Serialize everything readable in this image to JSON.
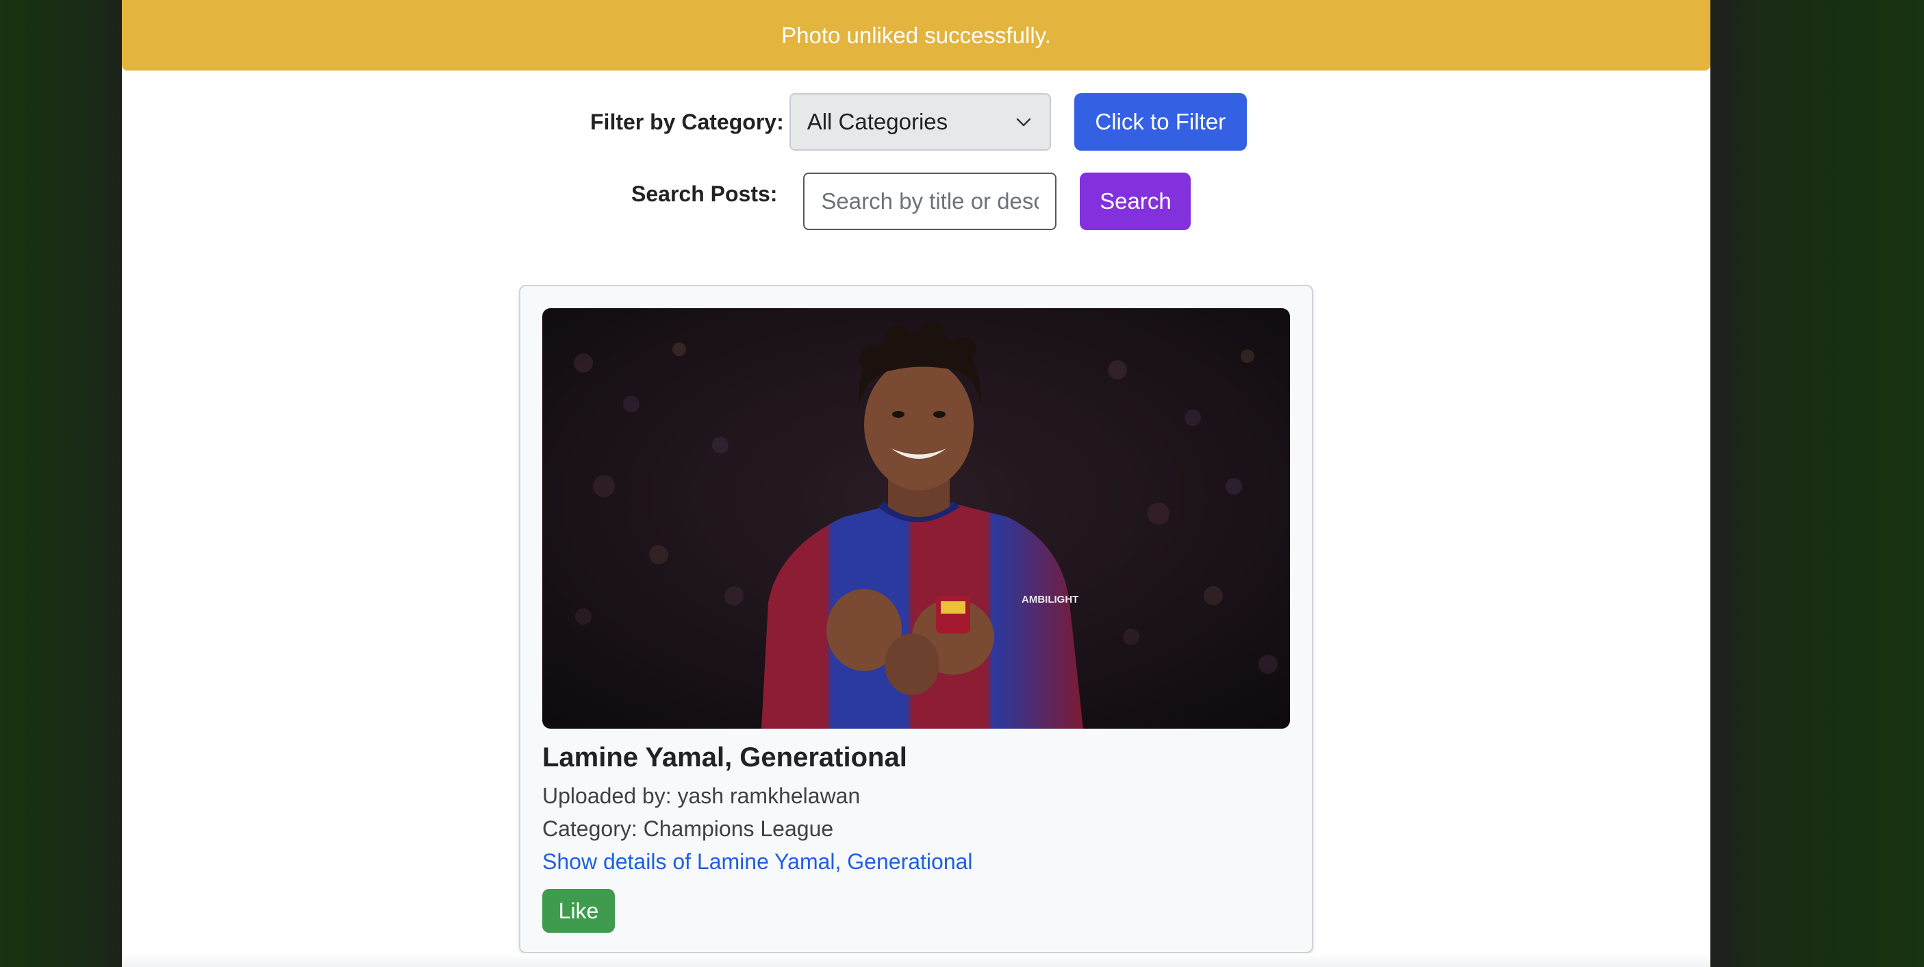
{
  "alert": {
    "message": "Photo unliked successfully."
  },
  "filter": {
    "label": "Filter by Category:",
    "selected_category": "All Categories",
    "button_label": "Click to Filter"
  },
  "search": {
    "label": "Search Posts:",
    "placeholder": "Search by title or description",
    "button_label": "Search"
  },
  "post": {
    "title": "Lamine Yamal, Generational",
    "uploaded_by": "Uploaded by: yash ramkhelawan",
    "category": "Category: Champions League",
    "details_link": "Show details of Lamine Yamal, Generational",
    "like_label": "Like",
    "photo_shirt_text": "AMBILIGHT"
  },
  "colors": {
    "alert_bg": "#e3b53f",
    "filter_button": "#3461e3",
    "search_button": "#8231dc",
    "like_button": "#3f9b4d",
    "link": "#1f5fe0"
  }
}
